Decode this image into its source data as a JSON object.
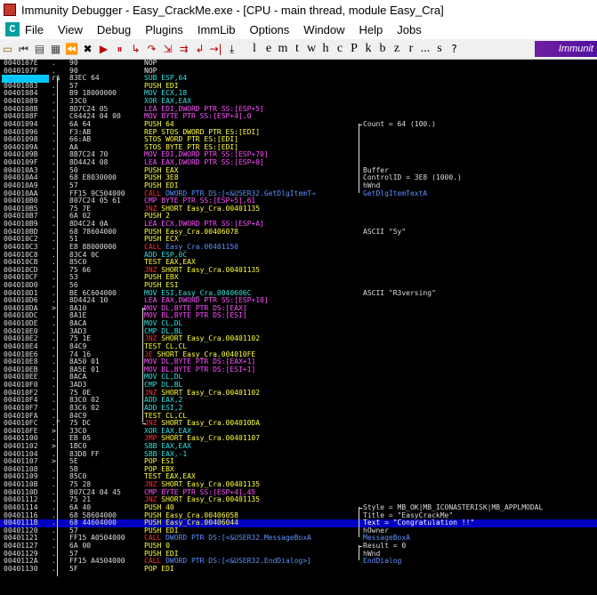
{
  "window": {
    "title": "Immunity Debugger - Easy_CrackMe.exe - [CPU - main thread, module Easy_Cra]"
  },
  "menu": [
    "File",
    "View",
    "Debug",
    "Plugins",
    "ImmLib",
    "Options",
    "Window",
    "Help",
    "Jobs"
  ],
  "toolbar": {
    "letters": [
      "l",
      "e",
      "m",
      "t",
      "w",
      "h",
      "c",
      "P",
      "k",
      "b",
      "z",
      "r",
      "...",
      "s"
    ],
    "immunity_label": "Immunit"
  },
  "rows": [
    {
      "a": "0040107E",
      "m": ".",
      "h": "90",
      "i": "NOP",
      "c": "",
      "k": "w"
    },
    {
      "a": "0040107F",
      "m": ".",
      "h": "90",
      "i": "NOP",
      "c": "",
      "k": "w"
    },
    {
      "a": "",
      "m": "r$",
      "h": "83EC 64",
      "i": "SUB ESP,64",
      "c": "",
      "k": "cy",
      "sel_addr": true
    },
    {
      "a": "00401083",
      "m": ".",
      "h": "57",
      "i": "PUSH EDI",
      "c": "",
      "k": "y"
    },
    {
      "a": "00401084",
      "m": ".",
      "h": "B9 18000000",
      "i": "MOV ECX,18",
      "c": "",
      "k": "cy"
    },
    {
      "a": "00401089",
      "m": ".",
      "h": "33C0",
      "i": "XOR EAX,EAX",
      "c": "",
      "k": "cy"
    },
    {
      "a": "0040108B",
      "m": ".",
      "h": "8D7C24 05",
      "i": "LEA EDI,DWORD PTR SS:[ESP+5]",
      "c": "",
      "k": "mg"
    },
    {
      "a": "0040108F",
      "m": ".",
      "h": "C64424 04 00",
      "i": "MOV BYTE PTR SS:[ESP+4],0",
      "c": "",
      "k": "mg"
    },
    {
      "a": "00401094",
      "m": ".",
      "h": "6A 64",
      "i": "PUSH 64",
      "c": "Count = 64 (100.)",
      "k": "y"
    },
    {
      "a": "00401096",
      "m": ".",
      "h": "F3:AB",
      "i": "REP STOS DWORD PTR ES:[EDI]",
      "c": "",
      "k": "y"
    },
    {
      "a": "00401098",
      "m": ".",
      "h": "66:AB",
      "i": "STOS WORD PTR ES:[EDI]",
      "c": "",
      "k": "y"
    },
    {
      "a": "0040109A",
      "m": ".",
      "h": "AA",
      "i": "STOS BYTE PTR ES:[EDI]",
      "c": "",
      "k": "y"
    },
    {
      "a": "0040109B",
      "m": ".",
      "h": "8B7C24 70",
      "i": "MOV EDI,DWORD PTR SS:[ESP+70]",
      "c": "",
      "k": "mg"
    },
    {
      "a": "0040109F",
      "m": ".",
      "h": "8D4424 08",
      "i": "LEA EAX,DWORD PTR SS:[ESP+8]",
      "c": "",
      "k": "mg"
    },
    {
      "a": "004010A3",
      "m": ".",
      "h": "50",
      "i": "PUSH EAX",
      "c": "Buffer",
      "k": "y"
    },
    {
      "a": "004010A4",
      "m": ".",
      "h": "68 E8030000",
      "i": "PUSH 3E8",
      "c": "ControlID = 3E8 (1000.)",
      "k": "y"
    },
    {
      "a": "004010A9",
      "m": ".",
      "h": "57",
      "i": "PUSH EDI",
      "c": "hWnd",
      "k": "y"
    },
    {
      "a": "004010AA",
      "m": ".",
      "h": "FF15 9C504000",
      "i": "CALL DWORD PTR DS:[<&USER32.GetDlgItemT→",
      "c": "GetDlgItemTextA",
      "k": "call"
    },
    {
      "a": "004010B0",
      "m": ".",
      "h": "807C24 05 61",
      "i": "CMP BYTE PTR SS:[ESP+5],61",
      "c": "",
      "k": "mg"
    },
    {
      "a": "004010B5",
      "m": ".",
      "h": "75 7E",
      "i": "JNZ SHORT Easy_Cra.00401135",
      "c": "",
      "k": "j"
    },
    {
      "a": "004010B7",
      "m": ".",
      "h": "6A 02",
      "i": "PUSH 2",
      "c": "",
      "k": "y"
    },
    {
      "a": "004010B9",
      "m": ".",
      "h": "8D4C24 0A",
      "i": "LEA ECX,DWORD PTR SS:[ESP+A]",
      "c": "",
      "k": "mg"
    },
    {
      "a": "004010BD",
      "m": ".",
      "h": "68 78604000",
      "i": "PUSH Easy_Cra.00406078",
      "c": "ASCII \"5y\"",
      "k": "y"
    },
    {
      "a": "004010C2",
      "m": ".",
      "h": "51",
      "i": "PUSH ECX",
      "c": "",
      "k": "y"
    },
    {
      "a": "004010C3",
      "m": ".",
      "h": "E8 88000000",
      "i": "CALL Easy_Cra.00401150",
      "c": "",
      "k": "call"
    },
    {
      "a": "004010C8",
      "m": ".",
      "h": "83C4 0C",
      "i": "ADD ESP,0C",
      "c": "",
      "k": "cy"
    },
    {
      "a": "004010CB",
      "m": ".",
      "h": "85C0",
      "i": "TEST EAX,EAX",
      "c": "",
      "k": "y"
    },
    {
      "a": "004010CD",
      "m": ".",
      "h": "75 66",
      "i": "JNZ SHORT Easy_Cra.00401135",
      "c": "",
      "k": "j"
    },
    {
      "a": "004010CF",
      "m": ".",
      "h": "53",
      "i": "PUSH EBX",
      "c": "",
      "k": "y"
    },
    {
      "a": "004010D0",
      "m": ".",
      "h": "56",
      "i": "PUSH ESI",
      "c": "",
      "k": "y"
    },
    {
      "a": "004010D1",
      "m": ".",
      "h": "BE 6C604000",
      "i": "MOV ESI,Easy_Cra.0040606C",
      "c": "ASCII \"R3versing\"",
      "k": "cy"
    },
    {
      "a": "004010D6",
      "m": ".",
      "h": "8D4424 10",
      "i": "LEA EAX,DWORD PTR SS:[ESP+10]",
      "c": "",
      "k": "mg"
    },
    {
      "a": "004010DA",
      "m": ">",
      "h": "8A10",
      "i": "MOV DL,BYTE PTR DS:[EAX]",
      "c": "",
      "k": "mg"
    },
    {
      "a": "004010DC",
      "m": ".",
      "h": "8A1E",
      "i": "MOV BL,BYTE PTR DS:[ESI]",
      "c": "",
      "k": "mg"
    },
    {
      "a": "004010DE",
      "m": ".",
      "h": "8ACA",
      "i": "MOV CL,DL",
      "c": "",
      "k": "cy"
    },
    {
      "a": "004010E0",
      "m": ".",
      "h": "3AD3",
      "i": "CMP DL,BL",
      "c": "",
      "k": "cy"
    },
    {
      "a": "004010E2",
      "m": ".",
      "h": "75 1E",
      "i": "JNZ SHORT Easy_Cra.00401102",
      "c": "",
      "k": "j"
    },
    {
      "a": "004010E4",
      "m": ".",
      "h": "84C9",
      "i": "TEST CL,CL",
      "c": "",
      "k": "y"
    },
    {
      "a": "004010E6",
      "m": ".",
      "h": "74 16",
      "i": "JE SHORT Easy_Cra.004010FE",
      "c": "",
      "k": "j"
    },
    {
      "a": "004010E8",
      "m": ".",
      "h": "8A50 01",
      "i": "MOV DL,BYTE PTR DS:[EAX+1]",
      "c": "",
      "k": "mg"
    },
    {
      "a": "004010EB",
      "m": ".",
      "h": "8A5E 01",
      "i": "MOV BL,BYTE PTR DS:[ESI+1]",
      "c": "",
      "k": "mg"
    },
    {
      "a": "004010EE",
      "m": ".",
      "h": "8ACA",
      "i": "MOV CL,DL",
      "c": "",
      "k": "cy"
    },
    {
      "a": "004010F0",
      "m": ".",
      "h": "3AD3",
      "i": "CMP DL,BL",
      "c": "",
      "k": "cy"
    },
    {
      "a": "004010F2",
      "m": ".",
      "h": "75 0E",
      "i": "JNZ SHORT Easy_Cra.00401102",
      "c": "",
      "k": "j"
    },
    {
      "a": "004010F4",
      "m": ".",
      "h": "83C0 02",
      "i": "ADD EAX,2",
      "c": "",
      "k": "cy"
    },
    {
      "a": "004010F7",
      "m": ".",
      "h": "83C6 02",
      "i": "ADD ESI,2",
      "c": "",
      "k": "cy"
    },
    {
      "a": "004010FA",
      "m": ".",
      "h": "84C9",
      "i": "TEST CL,CL",
      "c": "",
      "k": "y"
    },
    {
      "a": "004010FC",
      "m": ".^",
      "h": "75 DC",
      "i": "JNZ SHORT Easy_Cra.004010DA",
      "c": "",
      "k": "j"
    },
    {
      "a": "004010FE",
      "m": ">",
      "h": "33C0",
      "i": "XOR EAX,EAX",
      "c": "",
      "k": "cy"
    },
    {
      "a": "00401100",
      "m": ".",
      "h": "EB 05",
      "i": "JMP SHORT Easy_Cra.00401107",
      "c": "",
      "k": "j"
    },
    {
      "a": "00401102",
      "m": ">",
      "h": "1BC0",
      "i": "SBB EAX,EAX",
      "c": "",
      "k": "cy"
    },
    {
      "a": "00401104",
      "m": ".",
      "h": "83D8 FF",
      "i": "SBB EAX,-1",
      "c": "",
      "k": "cy"
    },
    {
      "a": "00401107",
      "m": ">",
      "h": "5E",
      "i": "POP ESI",
      "c": "",
      "k": "y"
    },
    {
      "a": "00401108",
      "m": ".",
      "h": "5B",
      "i": "POP EBX",
      "c": "",
      "k": "y"
    },
    {
      "a": "00401109",
      "m": ".",
      "h": "85C0",
      "i": "TEST EAX,EAX",
      "c": "",
      "k": "y"
    },
    {
      "a": "0040110B",
      "m": ".",
      "h": "75 28",
      "i": "JNZ SHORT Easy_Cra.00401135",
      "c": "",
      "k": "j"
    },
    {
      "a": "0040110D",
      "m": ".",
      "h": "807C24 04 45",
      "i": "CMP BYTE PTR SS:[ESP+4],45",
      "c": "",
      "k": "mg"
    },
    {
      "a": "00401112",
      "m": ".",
      "h": "75 21",
      "i": "JNZ SHORT Easy_Cra.00401135",
      "c": "",
      "k": "j"
    },
    {
      "a": "00401114",
      "m": ".",
      "h": "6A 40",
      "i": "PUSH 40",
      "c": "Style = MB_OK|MB_ICONASTERISK|MB_APPLMODAL",
      "k": "y"
    },
    {
      "a": "00401116",
      "m": ".",
      "h": "68 58604000",
      "i": "PUSH Easy_Cra.00406058",
      "c": "Title = \"EasyCrackMe\"",
      "k": "y"
    },
    {
      "a": "0040111B",
      "m": ".",
      "h": "68 44604000",
      "i": "PUSH Easy_Cra.00406044",
      "c": "Text = \"Congratulation !!\"",
      "k": "y",
      "selected": true
    },
    {
      "a": "00401120",
      "m": ".",
      "h": "57",
      "i": "PUSH EDI",
      "c": "hOwner",
      "k": "y"
    },
    {
      "a": "00401121",
      "m": ".",
      "h": "FF15 A0504000",
      "i": "CALL DWORD PTR DS:[<&USER32.MessageBoxA",
      "c": "MessageBoxA",
      "k": "call"
    },
    {
      "a": "00401127",
      "m": ".",
      "h": "6A 00",
      "i": "PUSH 0",
      "c": "Result = 0",
      "k": "y"
    },
    {
      "a": "00401129",
      "m": ".",
      "h": "57",
      "i": "PUSH EDI",
      "c": "hWnd",
      "k": "y"
    },
    {
      "a": "0040112A",
      "m": ".",
      "h": "FF15 A4504000",
      "i": "CALL DWORD PTR DS:[<&USER32.EndDialog>]",
      "c": "EndDialog",
      "k": "call"
    },
    {
      "a": "00401130",
      "m": ".",
      "h": "5F",
      "i": "POP EDI",
      "c": "",
      "k": "y"
    }
  ]
}
